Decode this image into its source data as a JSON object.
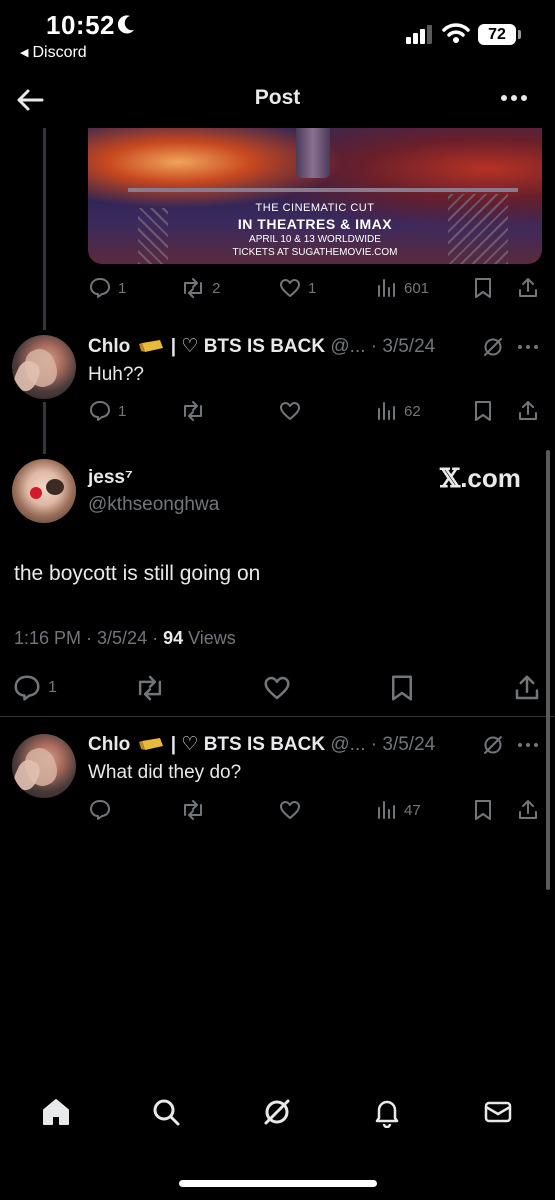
{
  "status_bar": {
    "time": "10:52",
    "back_app": "Discord",
    "battery": "72"
  },
  "header": {
    "title": "Post"
  },
  "media": {
    "line1": "THE CINEMATIC CUT",
    "line2": "IN THEATRES & IMAX",
    "line3": "APRIL 10 & 13 WORLDWIDE",
    "line4": "TICKETS AT SUGATHEMOVIE.COM"
  },
  "prev_tweet_actions": {
    "replies": "1",
    "reposts": "2",
    "likes": "1",
    "views": "601"
  },
  "reply_1": {
    "name": "Chlo",
    "name_suffix": "| ♡ BTS IS BACK",
    "handle": "@...",
    "date": "· 3/5/24",
    "text": "Huh??",
    "replies": "1",
    "views": "62"
  },
  "main_tweet": {
    "name": "jess⁷",
    "handle": "@kthseonghwa",
    "source_x": "𝕏",
    "source_com": ".com",
    "text": "the boycott is still going on",
    "time": "1:16 PM · 3/5/24 · ",
    "views_count": "94",
    "views_label": " Views",
    "replies": "1"
  },
  "reply_2": {
    "name": "Chlo",
    "name_suffix": "| ♡ BTS IS BACK",
    "handle": "@...",
    "date": "· 3/5/24",
    "text": "What did they do?",
    "views": "47"
  },
  "colors": {
    "background": "#000000",
    "text_primary": "#e7e9ea",
    "text_secondary": "#71767b",
    "divider": "#2f3336"
  },
  "icons": [
    "back-arrow-icon",
    "more-icon",
    "reply-icon",
    "repost-icon",
    "like-icon",
    "views-icon",
    "bookmark-icon",
    "share-icon",
    "grok-icon",
    "home-icon",
    "search-icon",
    "bell-icon",
    "mail-icon"
  ]
}
